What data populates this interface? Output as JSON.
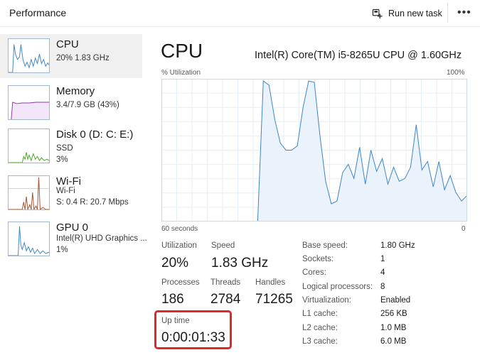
{
  "header": {
    "title": "Performance",
    "run_new_task": "Run new task",
    "more": "•••"
  },
  "sidebar": {
    "items": [
      {
        "name": "CPU",
        "lines": [
          "20%  1.83 GHz"
        ]
      },
      {
        "name": "Memory",
        "lines": [
          "3.4/7.9 GB (43%)"
        ]
      },
      {
        "name": "Disk 0 (D: C: E:)",
        "lines": [
          "SSD",
          "3%"
        ]
      },
      {
        "name": "Wi-Fi",
        "lines": [
          "Wi-Fi",
          "S: 0.4  R: 20.7 Mbps"
        ]
      },
      {
        "name": "GPU 0",
        "lines": [
          "Intel(R) UHD Graphics ...",
          "1%"
        ]
      }
    ]
  },
  "main": {
    "title": "CPU",
    "model": "Intel(R) Core(TM) i5-8265U CPU @ 1.60GHz",
    "graph": {
      "y_label": "% Utilization",
      "y_max_label": "100%",
      "x_left_label": "60 seconds",
      "x_right_label": "0"
    },
    "stats": {
      "utilization": {
        "label": "Utilization",
        "value": "20%"
      },
      "speed": {
        "label": "Speed",
        "value": "1.83 GHz"
      },
      "processes": {
        "label": "Processes",
        "value": "186"
      },
      "threads": {
        "label": "Threads",
        "value": "2784"
      },
      "handles": {
        "label": "Handles",
        "value": "71265"
      },
      "uptime": {
        "label": "Up time",
        "value": "0:00:01:33"
      }
    },
    "specs": [
      {
        "label": "Base speed:",
        "value": "1.80 GHz"
      },
      {
        "label": "Sockets:",
        "value": "1"
      },
      {
        "label": "Cores:",
        "value": "4"
      },
      {
        "label": "Logical processors:",
        "value": "8"
      },
      {
        "label": "Virtualization:",
        "value": "Enabled"
      },
      {
        "label": "L1 cache:",
        "value": "256 KB"
      },
      {
        "label": "L2 cache:",
        "value": "1.0 MB"
      },
      {
        "label": "L3 cache:",
        "value": "6.0 MB"
      }
    ]
  },
  "colors": {
    "cpu_line": "#3d85c6",
    "cpu_fill": "#eaf2fb",
    "grid": "#e6eef6",
    "memory_line": "#8b36b0",
    "disk_line": "#4ea72e",
    "wifi_line": "#a0522d",
    "gpu_line": "#3d85c6",
    "highlight": "#e0262a"
  },
  "chart_data": {
    "type": "area",
    "title": "",
    "xlabel": "",
    "ylabel": "% Utilization",
    "x_range_label": [
      "60 seconds",
      "0"
    ],
    "ylim": [
      0,
      100
    ],
    "grid": true,
    "values": [
      0,
      0,
      0,
      0,
      0,
      0,
      0,
      0,
      0,
      0,
      0,
      0,
      0,
      0,
      0,
      0,
      0,
      0,
      99,
      96,
      72,
      55,
      50,
      50,
      53,
      80,
      99,
      98,
      60,
      28,
      12,
      14,
      34,
      40,
      30,
      52,
      26,
      50,
      35,
      44,
      26,
      38,
      28,
      30,
      38,
      68,
      36,
      42,
      24,
      42,
      22,
      32,
      20,
      14,
      18
    ]
  }
}
